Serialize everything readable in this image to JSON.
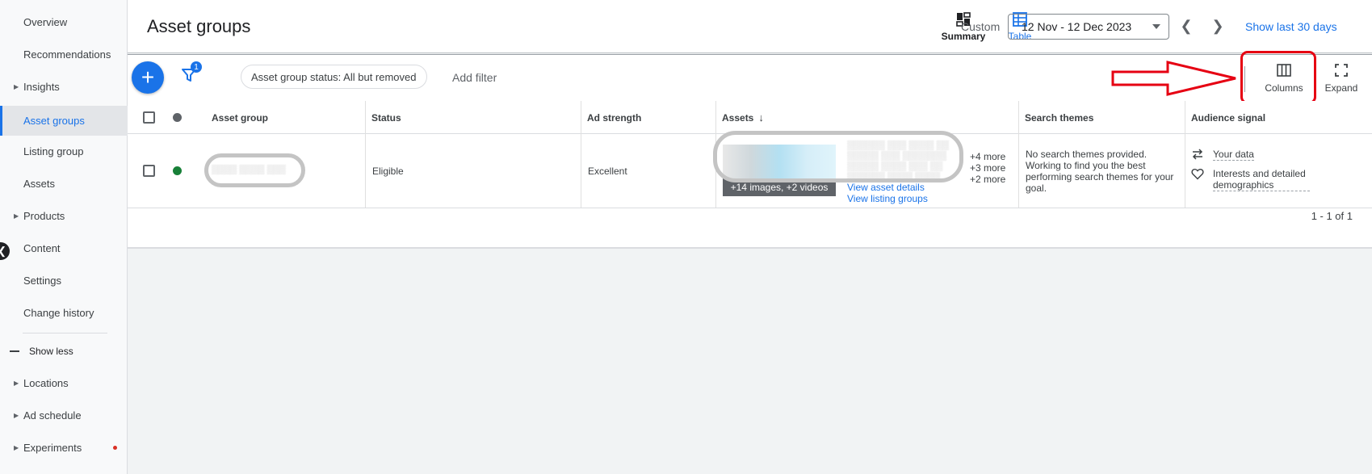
{
  "sidebar": {
    "items": [
      {
        "label": "Overview"
      },
      {
        "label": "Recommendations"
      },
      {
        "label": "Insights"
      },
      {
        "label": "Asset groups"
      },
      {
        "label": "Listing group"
      },
      {
        "label": "Assets"
      },
      {
        "label": "Products"
      },
      {
        "label": "Content"
      },
      {
        "label": "Settings"
      },
      {
        "label": "Change history"
      }
    ],
    "show_less": "Show less",
    "more_items": [
      {
        "label": "Locations"
      },
      {
        "label": "Ad schedule"
      },
      {
        "label": "Experiments"
      }
    ]
  },
  "header": {
    "title": "Asset groups",
    "summary_label": "Summary",
    "table_label": "Table",
    "custom_label": "Custom",
    "date_range": "12 Nov - 12 Dec 2023",
    "show_last": "Show last 30 days"
  },
  "toolbar": {
    "filter_count": "1",
    "status_filter": "Asset group status: All but removed",
    "add_filter": "Add filter",
    "columns_label": "Columns",
    "expand_label": "Expand"
  },
  "table": {
    "columns": [
      "Asset group",
      "Status",
      "Ad strength",
      "Assets",
      "Search themes",
      "Audience signal"
    ],
    "rows": [
      {
        "status": "Eligible",
        "ad_strength": "Excellent",
        "media_count": "+14 images, +2 videos",
        "more": [
          "+4 more",
          "+3 more",
          "+2 more"
        ],
        "links": [
          "View asset details",
          "View listing groups"
        ],
        "search_themes": "No search themes provided. Working to find you the best performing search themes for your goal.",
        "audience": [
          "Your data",
          "Interests and detailed demographics"
        ]
      }
    ],
    "pagination": "1 - 1 of 1"
  },
  "colors": {
    "accent": "#1a73e8",
    "status_green": "#188038",
    "annotation_red": "#e60012"
  }
}
